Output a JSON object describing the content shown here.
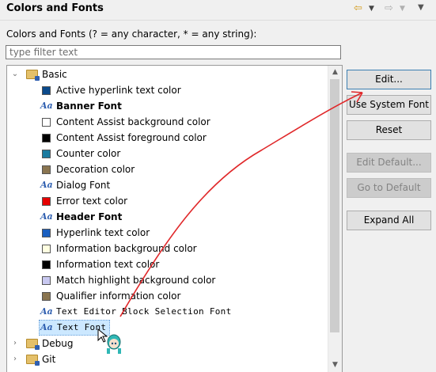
{
  "header": {
    "title": "Colors and Fonts",
    "nav_icons": [
      "back-arrow-icon",
      "dropdown-icon",
      "forward-arrow-icon",
      "dropdown-icon",
      "view-menu-icon"
    ]
  },
  "subtitle": "Colors and Fonts (? = any character, * = any string):",
  "filter": {
    "placeholder": "type filter text",
    "value": ""
  },
  "tree": {
    "groups": [
      {
        "label": "Basic",
        "expanded": true,
        "items": [
          {
            "kind": "color",
            "color": "#0b4a8b",
            "label": "Active hyperlink text color"
          },
          {
            "kind": "font",
            "style": "bold",
            "label": "Banner Font"
          },
          {
            "kind": "color",
            "color": "#ffffff",
            "label": "Content Assist background color"
          },
          {
            "kind": "color",
            "color": "#000000",
            "label": "Content Assist foreground color"
          },
          {
            "kind": "color",
            "color": "#1a7ba0",
            "label": "Counter color"
          },
          {
            "kind": "color",
            "color": "#8a7550",
            "label": "Decoration color"
          },
          {
            "kind": "font",
            "style": "normal",
            "label": "Dialog Font"
          },
          {
            "kind": "color",
            "color": "#e60000",
            "label": "Error text color"
          },
          {
            "kind": "font",
            "style": "bold",
            "label": "Header Font"
          },
          {
            "kind": "color",
            "color": "#1a5fc0",
            "label": "Hyperlink text color"
          },
          {
            "kind": "color",
            "color": "#ffffe1",
            "label": "Information background color"
          },
          {
            "kind": "color",
            "color": "#000000",
            "label": "Information text color"
          },
          {
            "kind": "color",
            "color": "#c8c8f0",
            "label": "Match highlight background color"
          },
          {
            "kind": "color",
            "color": "#8a7550",
            "label": "Qualifier information color"
          },
          {
            "kind": "font",
            "style": "mono",
            "label": "Text Editor Block Selection Font"
          },
          {
            "kind": "font",
            "style": "mono",
            "label": "Text Font",
            "selected": true
          }
        ]
      },
      {
        "label": "Debug",
        "expanded": false
      },
      {
        "label": "Git",
        "expanded": false
      }
    ]
  },
  "buttons": {
    "edit": "Edit...",
    "use_system_font": "Use System Font",
    "reset": "Reset",
    "edit_default": "Edit Default...",
    "go_to_default": "Go to Default",
    "expand_all": "Expand All"
  },
  "colors": {
    "annotation_arrow": "#e0282a",
    "selection": "#cce8ff",
    "folder_icon": "#e4c06a"
  }
}
